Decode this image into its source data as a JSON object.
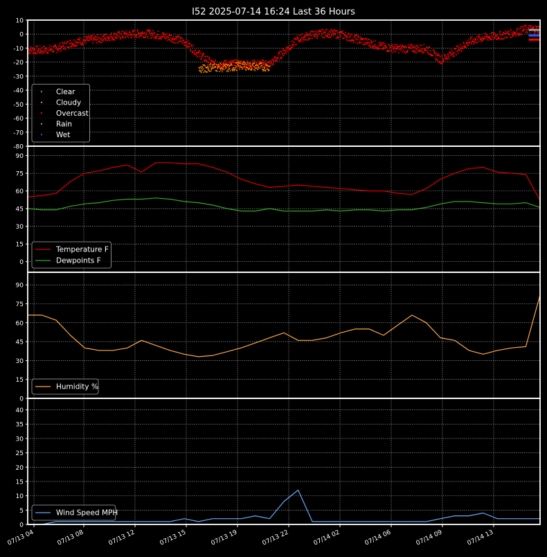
{
  "title": "I52 2025-07-14 16:24 Last 36 Hours",
  "x_ticks": [
    "07/13 04",
    "07/13 08",
    "07/13 12",
    "07/13 15",
    "07/13 19",
    "07/13 22",
    "07/14 02",
    "07/14 06",
    "07/14 09",
    "07/14 13"
  ],
  "colors": {
    "background": "#000000",
    "axis": "#ffffff",
    "grid": "#aaaaaa",
    "temperature": "#dd0000",
    "dewpoint": "#33aa22",
    "humidity": "#ffaa44",
    "wind": "#66aaff",
    "clear": "#22cc22",
    "cloudy": "#ff8800",
    "overcast": "#ff0000",
    "rain": "#999999",
    "wet": "#2255ff"
  },
  "chart_data": [
    {
      "type": "scatter",
      "ylim": [
        -80,
        10
      ],
      "yticks": [
        10,
        0,
        -10,
        -20,
        -30,
        -40,
        -50,
        -60,
        -70,
        -80
      ],
      "grid": true,
      "legend_position": "lower-left",
      "series": [
        {
          "name": "Clear",
          "color_key": "clear"
        },
        {
          "name": "Cloudy",
          "color_key": "cloudy"
        },
        {
          "name": "Overcast",
          "color_key": "overcast"
        },
        {
          "name": "Rain",
          "color_key": "rain"
        },
        {
          "name": "Wet",
          "color_key": "wet"
        }
      ],
      "x": [
        0,
        1,
        2,
        3,
        4,
        5,
        6,
        7,
        8,
        9,
        10,
        11,
        12,
        13,
        14,
        15,
        16,
        17,
        18,
        19,
        20,
        21,
        22,
        23,
        24,
        25,
        26,
        27,
        28,
        29,
        30,
        31,
        32,
        33,
        34,
        35,
        36
      ],
      "values": {
        "Overcast": [
          -11,
          -11,
          -10,
          -6,
          -4,
          -3,
          -1,
          0,
          1,
          0,
          -2,
          -5,
          -14,
          -21,
          -21,
          -21,
          -21,
          -21,
          -12,
          -3,
          0,
          1,
          0,
          -3,
          -6,
          -9,
          -10,
          -10,
          -10,
          -18,
          -12,
          -5,
          -2,
          -1,
          1,
          4,
          4
        ],
        "Cloudy": [
          null,
          null,
          null,
          null,
          null,
          null,
          null,
          null,
          null,
          null,
          null,
          null,
          -25,
          -23,
          -24,
          -22,
          -23,
          null,
          null,
          null,
          null,
          null,
          null,
          null,
          null,
          null,
          null,
          null,
          null,
          null,
          null,
          null,
          null,
          null,
          null,
          null,
          null
        ]
      }
    },
    {
      "type": "line",
      "ylim": [
        -9,
        98
      ],
      "yticks": [
        90,
        75,
        60,
        45,
        30,
        15,
        0
      ],
      "grid": true,
      "legend_position": "lower-left",
      "x": [
        0,
        1,
        2,
        3,
        4,
        5,
        6,
        7,
        8,
        9,
        10,
        11,
        12,
        13,
        14,
        15,
        16,
        17,
        18,
        19,
        20,
        21,
        22,
        23,
        24,
        25,
        26,
        27,
        28,
        29,
        30,
        31,
        32,
        33,
        34,
        35,
        36
      ],
      "series": [
        {
          "name": "Temperature F",
          "color_key": "temperature",
          "values": [
            55,
            56,
            58,
            68,
            75,
            77,
            80,
            82,
            76,
            84,
            84,
            83,
            83,
            80,
            76,
            70,
            66,
            63,
            64,
            65,
            64,
            63,
            62,
            61,
            60,
            60,
            58,
            57,
            62,
            70,
            75,
            79,
            80,
            76,
            75,
            74,
            52
          ]
        },
        {
          "name": "Dewpoints F",
          "color_key": "dewpoint",
          "values": [
            45,
            44,
            44,
            47,
            49,
            50,
            52,
            53,
            53,
            54,
            53,
            51,
            50,
            48,
            45,
            43,
            43,
            45,
            43,
            43,
            43,
            44,
            43,
            44,
            44,
            43,
            44,
            44,
            46,
            49,
            51,
            51,
            50,
            49,
            49,
            50,
            46
          ]
        }
      ]
    },
    {
      "type": "line",
      "ylim": [
        0,
        100
      ],
      "yticks": [
        90,
        75,
        60,
        45,
        30,
        15,
        0
      ],
      "grid": true,
      "legend_position": "lower-left",
      "x": [
        0,
        1,
        2,
        3,
        4,
        5,
        6,
        7,
        8,
        9,
        10,
        11,
        12,
        13,
        14,
        15,
        16,
        17,
        18,
        19,
        20,
        21,
        22,
        23,
        24,
        25,
        26,
        27,
        28,
        29,
        30,
        31,
        32,
        33,
        34,
        35,
        36
      ],
      "series": [
        {
          "name": "Humidity %",
          "color_key": "humidity",
          "values": [
            66,
            66,
            62,
            50,
            40,
            38,
            38,
            40,
            46,
            42,
            38,
            35,
            33,
            34,
            37,
            40,
            44,
            48,
            52,
            46,
            46,
            48,
            52,
            55,
            55,
            50,
            58,
            66,
            60,
            48,
            46,
            38,
            35,
            38,
            40,
            41,
            82
          ]
        }
      ]
    },
    {
      "type": "line",
      "ylim": [
        0,
        44
      ],
      "yticks": [
        40,
        35,
        30,
        25,
        20,
        15,
        10,
        5,
        0
      ],
      "grid": true,
      "legend_position": "lower-left",
      "x": [
        0,
        1,
        2,
        3,
        4,
        5,
        6,
        7,
        8,
        9,
        10,
        11,
        12,
        13,
        14,
        15,
        16,
        17,
        18,
        19,
        20,
        21,
        22,
        23,
        24,
        25,
        26,
        27,
        28,
        29,
        30,
        31,
        32,
        33,
        34,
        35,
        36
      ],
      "series": [
        {
          "name": "Wind Speed MPH",
          "color_key": "wind",
          "values": [
            0,
            0,
            1,
            1,
            1,
            1,
            1,
            1,
            1,
            1,
            1,
            2,
            1,
            2,
            2,
            2,
            3,
            2,
            8,
            12,
            1,
            1,
            1,
            1,
            1,
            1,
            1,
            1,
            1,
            2,
            3,
            3,
            4,
            2,
            2,
            2,
            2
          ]
        }
      ]
    }
  ]
}
